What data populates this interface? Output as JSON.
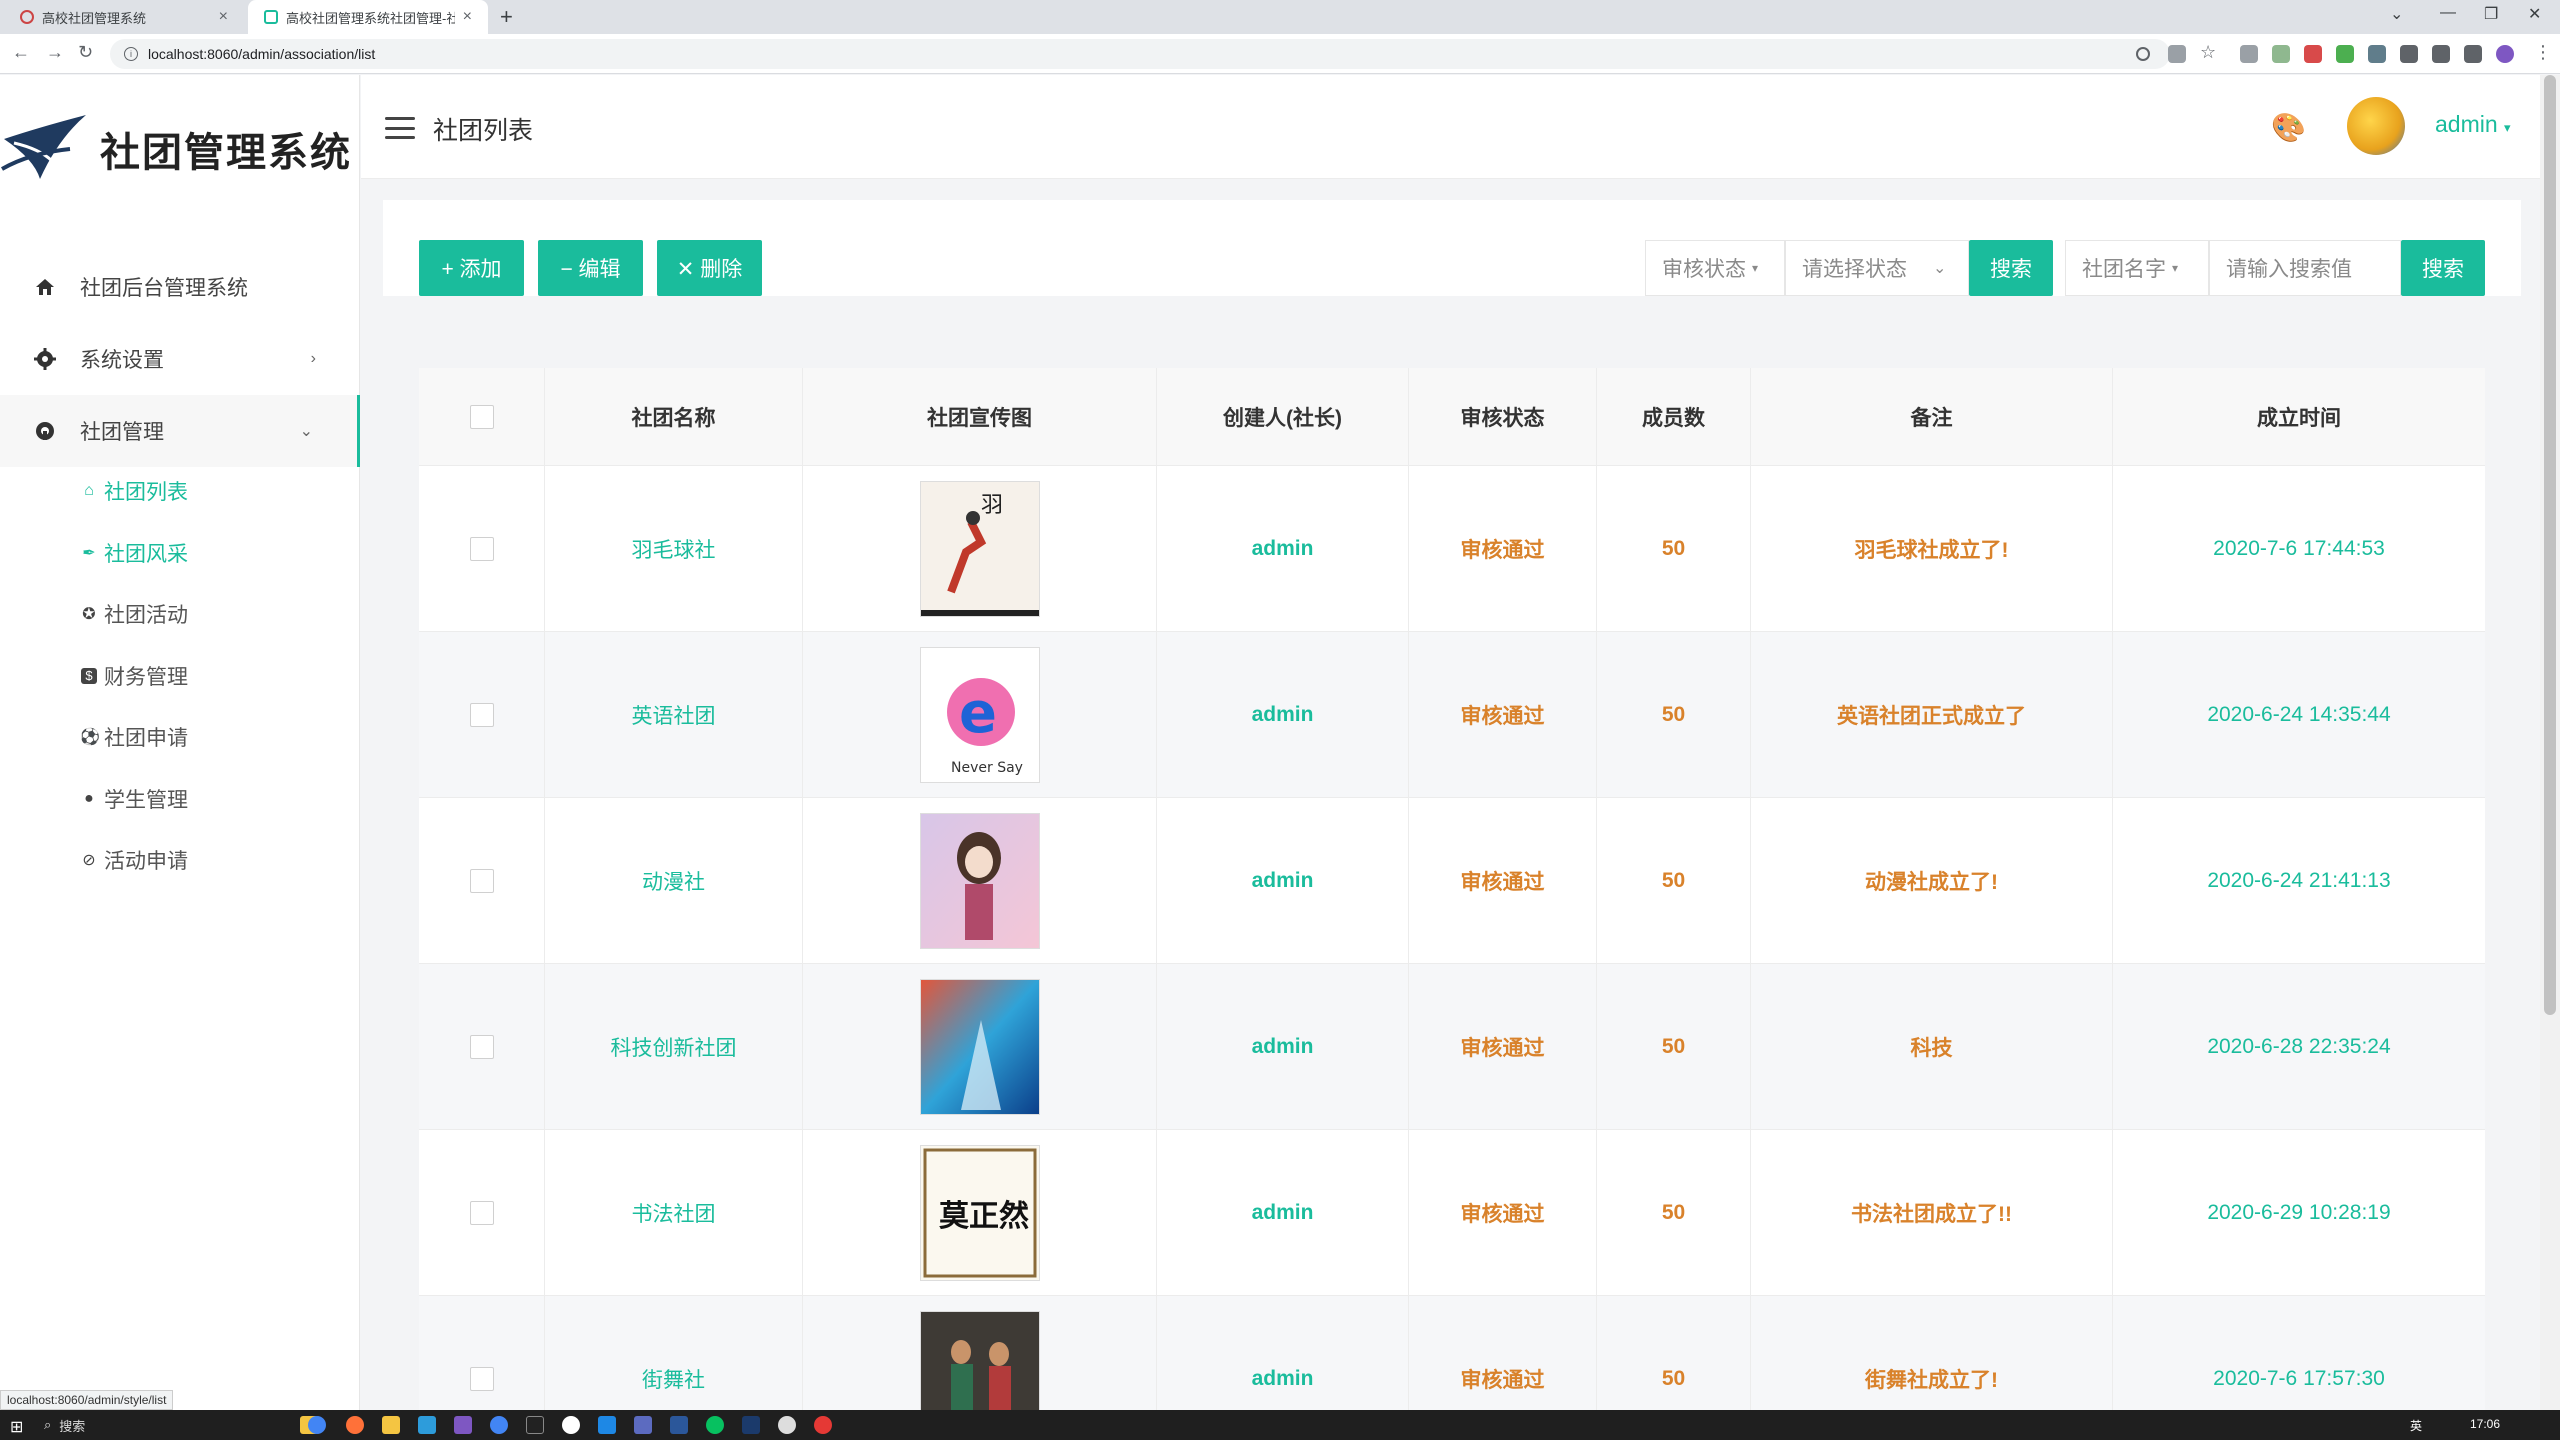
{
  "browser": {
    "tabs": [
      {
        "label": "高校社团管理系统"
      },
      {
        "label": "高校社团管理系统社团管理-社团"
      }
    ],
    "url": "localhost:8060/admin/association/list",
    "status_url": "localhost:8060/admin/style/list"
  },
  "sidebar": {
    "logo_text": "社团管理系统",
    "menu": [
      {
        "label": "社团后台管理系统",
        "icon": "home-icon"
      },
      {
        "label": "系统设置",
        "icon": "gear-icon"
      },
      {
        "label": "社团管理",
        "icon": "org-icon"
      }
    ],
    "sub_items": [
      {
        "label": "社团列表",
        "icon": "home-icon"
      },
      {
        "label": "社团风采",
        "icon": "feather-icon"
      },
      {
        "label": "社团活动",
        "icon": "star-icon"
      },
      {
        "label": "财务管理",
        "icon": "dollar-icon"
      },
      {
        "label": "社团申请",
        "icon": "soccer-icon"
      },
      {
        "label": "学生管理",
        "icon": "user-icon"
      },
      {
        "label": "活动申请",
        "icon": "ban-icon"
      }
    ]
  },
  "header": {
    "title": "社团列表",
    "user": "admin"
  },
  "toolbar": {
    "add_label": "+ 添加",
    "edit_label": "− 编辑",
    "delete_label": "✕ 删除",
    "status_filter": "审核状态",
    "status_placeholder": "请选择状态",
    "search_label": "搜索",
    "name_filter": "社团名字",
    "search_placeholder": "请输入搜索值",
    "search2_label": "搜索"
  },
  "table": {
    "columns": [
      "社团名称",
      "社团宣传图",
      "创建人(社长)",
      "审核状态",
      "成员数",
      "备注",
      "成立时间"
    ],
    "rows": [
      {
        "name": "羽毛球社",
        "creator": "admin",
        "status": "审核通过",
        "members": "50",
        "note": "羽毛球社成立了!",
        "date": "2020-7-6 17:44:53",
        "img": "badminton"
      },
      {
        "name": "英语社团",
        "creator": "admin",
        "status": "审核通过",
        "members": "50",
        "note": "英语社团正式成立了",
        "date": "2020-6-24 14:35:44",
        "img": "english"
      },
      {
        "name": "动漫社",
        "creator": "admin",
        "status": "审核通过",
        "members": "50",
        "note": "动漫社成立了!",
        "date": "2020-6-24 21:41:13",
        "img": "anime"
      },
      {
        "name": "科技创新社团",
        "creator": "admin",
        "status": "审核通过",
        "members": "50",
        "note": "科技",
        "date": "2020-6-28 22:35:24",
        "img": "tech"
      },
      {
        "name": "书法社团",
        "creator": "admin",
        "status": "审核通过",
        "members": "50",
        "note": "书法社团成立了!!",
        "date": "2020-6-29 10:28:19",
        "img": "calligraphy"
      },
      {
        "name": "街舞社",
        "creator": "admin",
        "status": "审核通过",
        "members": "50",
        "note": "街舞社成立了!",
        "date": "2020-7-6 17:57:30",
        "img": "dance"
      }
    ]
  },
  "taskbar": {
    "search": "搜索",
    "lang": "英",
    "time": "17:06"
  },
  "colors": {
    "accent": "#1abc9c",
    "warn": "#d9822b"
  }
}
